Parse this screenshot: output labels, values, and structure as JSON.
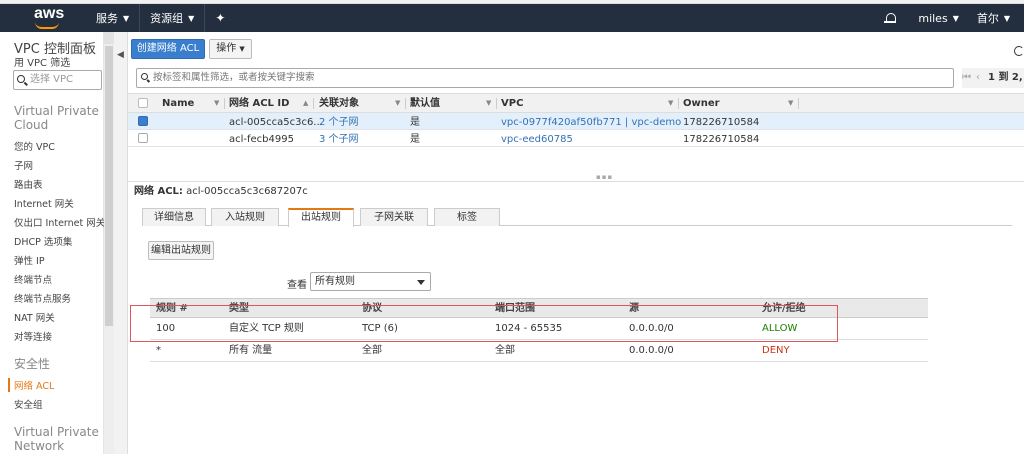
{
  "topnav": {
    "logo": "aws",
    "services": "服务",
    "resource_groups": "资源组",
    "user": "miles",
    "region": "首尔"
  },
  "sidebar": {
    "title": "VPC 控制面板",
    "filter_label": "用 VPC 筛选",
    "search_placeholder": "选择 VPC",
    "section_vpc": "Virtual Private Cloud",
    "items": [
      "您的 VPC",
      "子网",
      "路由表",
      "Internet 网关",
      "仅出口 Internet 网关",
      "DHCP 选项集",
      "弹性 IP",
      "终端节点",
      "终端节点服务",
      "NAT 网关",
      "对等连接"
    ],
    "section_security": "安全性",
    "security_items": [
      "网络 ACL",
      "安全组"
    ],
    "section_vpn": "Virtual Private Network (VPN)"
  },
  "toolbar": {
    "create_label": "创建网络 ACL",
    "actions_label": "操作"
  },
  "filter": {
    "placeholder": "按标签和属性筛选，或者按关键字搜索"
  },
  "pager": {
    "text": "1 到 2,"
  },
  "grid": {
    "columns": [
      "Name",
      "网络 ACL ID",
      "关联对象",
      "默认值",
      "VPC",
      "Owner"
    ],
    "rows": [
      {
        "name": "",
        "acl_id": "acl-005cca5c3c6...",
        "assoc": "2 个子网",
        "default": "是",
        "vpc": "vpc-0977f420af50fb771 | vpc-demo",
        "owner": "178226710584",
        "selected": true
      },
      {
        "name": "",
        "acl_id": "acl-fecb4995",
        "assoc": "3 个子网",
        "default": "是",
        "vpc": "vpc-eed60785",
        "owner": "178226710584",
        "selected": false
      }
    ]
  },
  "detail": {
    "label": "网络 ACL:",
    "acl_id": "acl-005cca5c3c687207c",
    "tabs": [
      "详细信息",
      "入站规则",
      "出站规则",
      "子网关联",
      "标签"
    ],
    "active_tab": "出站规则",
    "edit_button": "编辑出站规则",
    "view_label": "查看",
    "view_value": "所有规则"
  },
  "rules": {
    "columns": [
      "规则 #",
      "类型",
      "协议",
      "端口范围",
      "源",
      "允许/拒绝"
    ],
    "rows": [
      {
        "num": "100",
        "type": "自定义 TCP 规则",
        "protocol": "TCP (6)",
        "ports": "1024 - 65535",
        "source": "0.0.0.0/0",
        "action": "ALLOW"
      },
      {
        "num": "*",
        "type": "所有 流量",
        "protocol": "全部",
        "ports": "全部",
        "source": "0.0.0.0/0",
        "action": "DENY"
      }
    ]
  },
  "colors": {
    "nav_bg": "#232f3e",
    "accent_orange": "#e47911",
    "primary_blue": "#3a7fce",
    "allow_green": "#1d8102",
    "deny_red": "#d13212",
    "highlight_red": "#e0545c"
  }
}
